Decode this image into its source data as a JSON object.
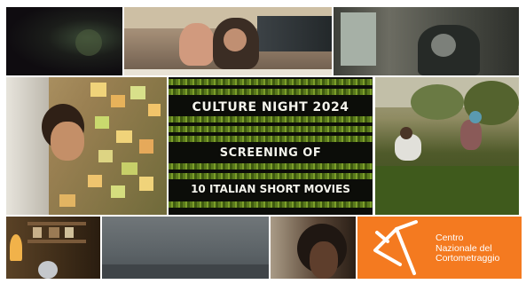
{
  "title_panel": {
    "line1": "CULTURE NIGHT 2024",
    "line2": "SCREENING OF",
    "line3": "10 ITALIAN SHORT MOVIES"
  },
  "logo": {
    "line1": "Centro",
    "line2": "Nazionale del",
    "line3": "Cortometraggio",
    "icon": "cnc-logo-icon"
  },
  "colors": {
    "brand_orange": "#f47a20",
    "title_text": "#f4f4ec",
    "stripe_green": "#6f8f22"
  }
}
